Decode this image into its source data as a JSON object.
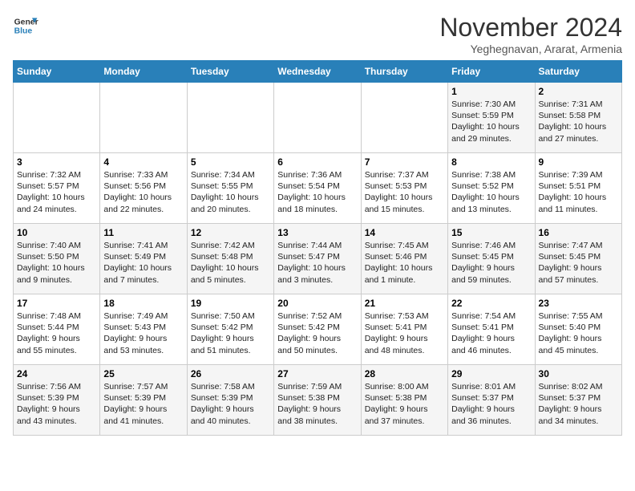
{
  "header": {
    "logo_line1": "General",
    "logo_line2": "Blue",
    "month": "November 2024",
    "location": "Yeghegnavan, Ararat, Armenia"
  },
  "weekdays": [
    "Sunday",
    "Monday",
    "Tuesday",
    "Wednesday",
    "Thursday",
    "Friday",
    "Saturday"
  ],
  "weeks": [
    [
      {
        "day": "",
        "info": ""
      },
      {
        "day": "",
        "info": ""
      },
      {
        "day": "",
        "info": ""
      },
      {
        "day": "",
        "info": ""
      },
      {
        "day": "",
        "info": ""
      },
      {
        "day": "1",
        "info": "Sunrise: 7:30 AM\nSunset: 5:59 PM\nDaylight: 10 hours\nand 29 minutes."
      },
      {
        "day": "2",
        "info": "Sunrise: 7:31 AM\nSunset: 5:58 PM\nDaylight: 10 hours\nand 27 minutes."
      }
    ],
    [
      {
        "day": "3",
        "info": "Sunrise: 7:32 AM\nSunset: 5:57 PM\nDaylight: 10 hours\nand 24 minutes."
      },
      {
        "day": "4",
        "info": "Sunrise: 7:33 AM\nSunset: 5:56 PM\nDaylight: 10 hours\nand 22 minutes."
      },
      {
        "day": "5",
        "info": "Sunrise: 7:34 AM\nSunset: 5:55 PM\nDaylight: 10 hours\nand 20 minutes."
      },
      {
        "day": "6",
        "info": "Sunrise: 7:36 AM\nSunset: 5:54 PM\nDaylight: 10 hours\nand 18 minutes."
      },
      {
        "day": "7",
        "info": "Sunrise: 7:37 AM\nSunset: 5:53 PM\nDaylight: 10 hours\nand 15 minutes."
      },
      {
        "day": "8",
        "info": "Sunrise: 7:38 AM\nSunset: 5:52 PM\nDaylight: 10 hours\nand 13 minutes."
      },
      {
        "day": "9",
        "info": "Sunrise: 7:39 AM\nSunset: 5:51 PM\nDaylight: 10 hours\nand 11 minutes."
      }
    ],
    [
      {
        "day": "10",
        "info": "Sunrise: 7:40 AM\nSunset: 5:50 PM\nDaylight: 10 hours\nand 9 minutes."
      },
      {
        "day": "11",
        "info": "Sunrise: 7:41 AM\nSunset: 5:49 PM\nDaylight: 10 hours\nand 7 minutes."
      },
      {
        "day": "12",
        "info": "Sunrise: 7:42 AM\nSunset: 5:48 PM\nDaylight: 10 hours\nand 5 minutes."
      },
      {
        "day": "13",
        "info": "Sunrise: 7:44 AM\nSunset: 5:47 PM\nDaylight: 10 hours\nand 3 minutes."
      },
      {
        "day": "14",
        "info": "Sunrise: 7:45 AM\nSunset: 5:46 PM\nDaylight: 10 hours\nand 1 minute."
      },
      {
        "day": "15",
        "info": "Sunrise: 7:46 AM\nSunset: 5:45 PM\nDaylight: 9 hours\nand 59 minutes."
      },
      {
        "day": "16",
        "info": "Sunrise: 7:47 AM\nSunset: 5:45 PM\nDaylight: 9 hours\nand 57 minutes."
      }
    ],
    [
      {
        "day": "17",
        "info": "Sunrise: 7:48 AM\nSunset: 5:44 PM\nDaylight: 9 hours\nand 55 minutes."
      },
      {
        "day": "18",
        "info": "Sunrise: 7:49 AM\nSunset: 5:43 PM\nDaylight: 9 hours\nand 53 minutes."
      },
      {
        "day": "19",
        "info": "Sunrise: 7:50 AM\nSunset: 5:42 PM\nDaylight: 9 hours\nand 51 minutes."
      },
      {
        "day": "20",
        "info": "Sunrise: 7:52 AM\nSunset: 5:42 PM\nDaylight: 9 hours\nand 50 minutes."
      },
      {
        "day": "21",
        "info": "Sunrise: 7:53 AM\nSunset: 5:41 PM\nDaylight: 9 hours\nand 48 minutes."
      },
      {
        "day": "22",
        "info": "Sunrise: 7:54 AM\nSunset: 5:41 PM\nDaylight: 9 hours\nand 46 minutes."
      },
      {
        "day": "23",
        "info": "Sunrise: 7:55 AM\nSunset: 5:40 PM\nDaylight: 9 hours\nand 45 minutes."
      }
    ],
    [
      {
        "day": "24",
        "info": "Sunrise: 7:56 AM\nSunset: 5:39 PM\nDaylight: 9 hours\nand 43 minutes."
      },
      {
        "day": "25",
        "info": "Sunrise: 7:57 AM\nSunset: 5:39 PM\nDaylight: 9 hours\nand 41 minutes."
      },
      {
        "day": "26",
        "info": "Sunrise: 7:58 AM\nSunset: 5:39 PM\nDaylight: 9 hours\nand 40 minutes."
      },
      {
        "day": "27",
        "info": "Sunrise: 7:59 AM\nSunset: 5:38 PM\nDaylight: 9 hours\nand 38 minutes."
      },
      {
        "day": "28",
        "info": "Sunrise: 8:00 AM\nSunset: 5:38 PM\nDaylight: 9 hours\nand 37 minutes."
      },
      {
        "day": "29",
        "info": "Sunrise: 8:01 AM\nSunset: 5:37 PM\nDaylight: 9 hours\nand 36 minutes."
      },
      {
        "day": "30",
        "info": "Sunrise: 8:02 AM\nSunset: 5:37 PM\nDaylight: 9 hours\nand 34 minutes."
      }
    ]
  ]
}
